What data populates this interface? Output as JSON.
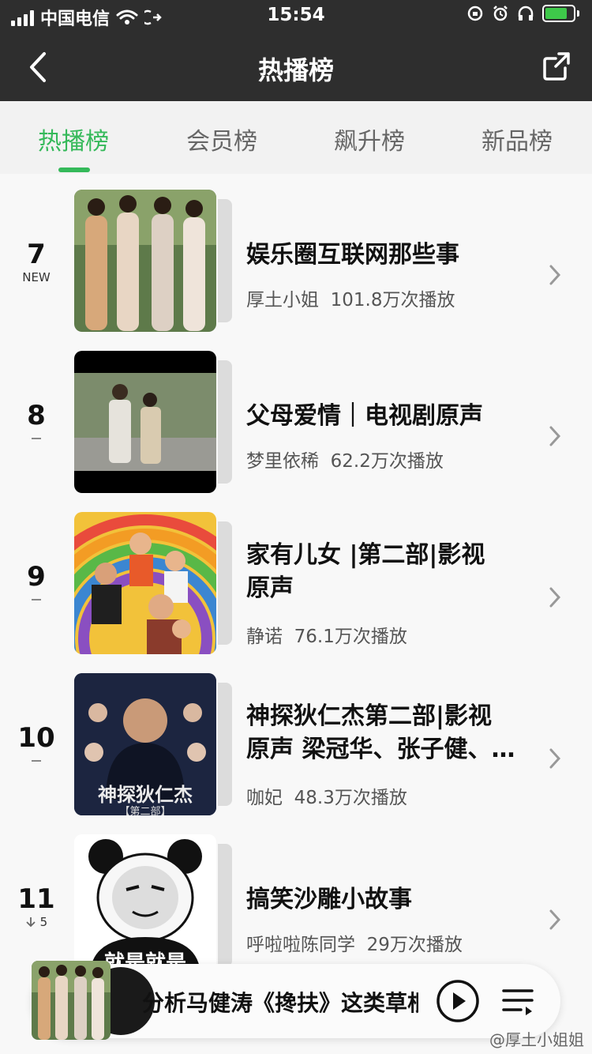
{
  "status_bar": {
    "carrier": "中国电信",
    "time": "15:54"
  },
  "nav": {
    "title": "热播榜"
  },
  "tabs": [
    {
      "label": "热播榜",
      "active": true
    },
    {
      "label": "会员榜",
      "active": false
    },
    {
      "label": "飙升榜",
      "active": false
    },
    {
      "label": "新品榜",
      "active": false
    }
  ],
  "items": [
    {
      "rank": "7",
      "badge": "NEW",
      "title_lines": [
        "娱乐圈互联网那些事",
        ""
      ],
      "artist": "厚土小姐",
      "plays": "101.8万次播放"
    },
    {
      "rank": "8",
      "badge": "",
      "title_lines": [
        "父母爱情｜电视剧原声",
        ""
      ],
      "artist": "梦里依稀",
      "plays": "62.2万次播放"
    },
    {
      "rank": "9",
      "badge": "",
      "title_lines": [
        " 家有儿女 |第二部|影视",
        "原声"
      ],
      "artist": "静诺",
      "plays": "76.1万次播放"
    },
    {
      "rank": "10",
      "badge": "",
      "title_lines": [
        "神探狄仁杰第二部|影视",
        "原声 梁冠华、张子健、…"
      ],
      "artist": "咖妃",
      "plays": "48.3万次播放"
    },
    {
      "rank": "11",
      "badge": "5",
      "title_lines": [
        "搞笑沙雕小故事",
        ""
      ],
      "artist": "呼啦啦陈同学",
      "plays": "29万次播放"
    }
  ],
  "covers": {
    "cover_4_text": "神探狄仁杰",
    "cover_4_sub": "【第二部】",
    "cover_5_text": "就是就是"
  },
  "player": {
    "now_playing": "分析马健涛《搀扶》这类草根"
  },
  "watermark": "@厚土小姐姐",
  "colors": {
    "accent": "#35b95a",
    "header": "#2e2e2e"
  }
}
